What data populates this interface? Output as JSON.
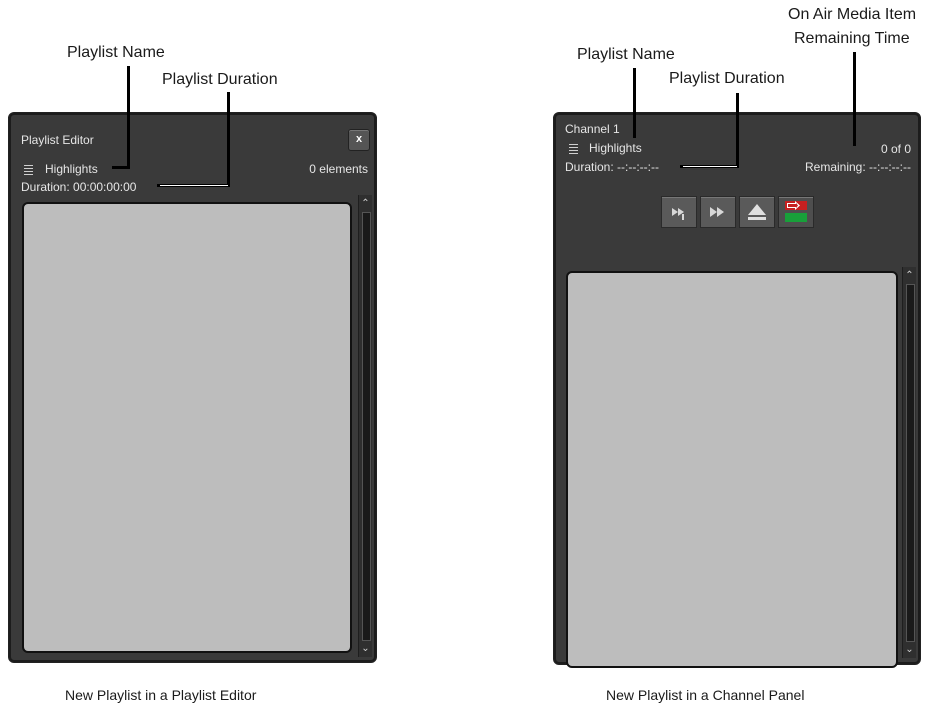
{
  "callouts": {
    "left_playlist_name": "Playlist Name",
    "left_playlist_duration": "Playlist Duration",
    "right_playlist_name": "Playlist Name",
    "right_playlist_duration": "Playlist Duration",
    "right_on_air_line1": "On Air Media Item",
    "right_on_air_line2": "Remaining Time"
  },
  "editor_panel": {
    "title": "Playlist Editor",
    "close_label": "x",
    "playlist_name": "Highlights",
    "element_count": "0 elements",
    "duration": "Duration: 00:00:00:00"
  },
  "channel_panel": {
    "channel": "Channel 1",
    "playlist_name": "Highlights",
    "position": "0 of 0",
    "duration": "Duration: --:--:--:--",
    "remaining": "Remaining: --:--:--:--",
    "transport_buttons": [
      "play-next",
      "skip-forward",
      "eject",
      "switch-out"
    ]
  },
  "captions": {
    "left": "New Playlist in a Playlist Editor",
    "right": "New Playlist in a Channel Panel"
  }
}
